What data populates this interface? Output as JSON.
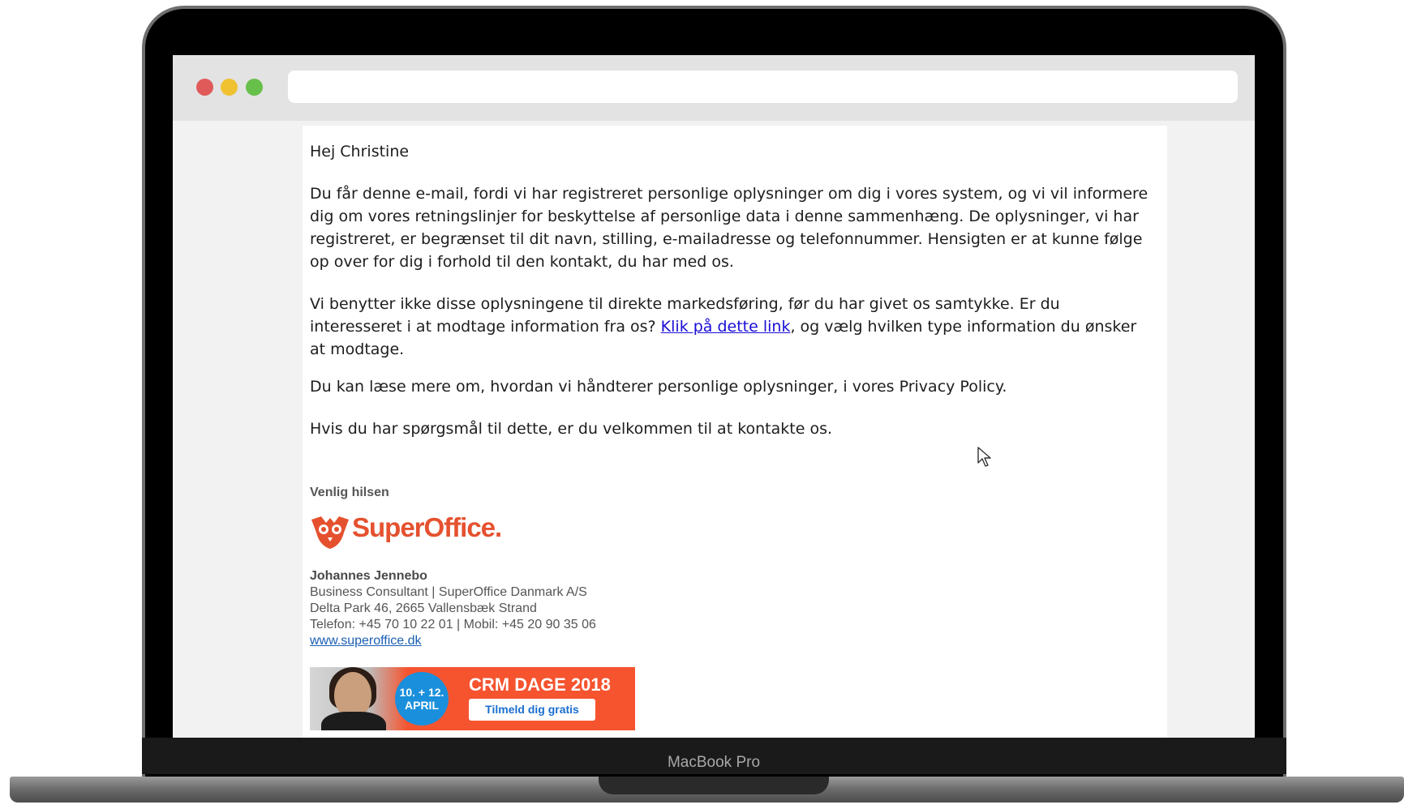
{
  "device": {
    "model_label": "MacBook Pro"
  },
  "email": {
    "greeting": "Hej Christine",
    "paragraphs": [
      "Du får denne e-mail, fordi vi har registreret personlige oplysninger om dig i vores system, og vi vil informere dig om vores retningslinjer for beskyttelse af personlige data i denne sammenhæng. De oplysninger, vi har registreret, er begrænset til dit navn, stilling, e-mailadresse og telefonnummer. Hensigten er at kunne følge op over for dig i forhold til den kontakt, du har med os.",
      "Du kan læse mere om, hvordan vi håndterer personlige oplysninger, i vores Privacy Policy.",
      "Hvis du har spørgsmål til dette, er du velkommen til at kontakte os."
    ],
    "para2_before": "Vi benytter ikke disse oplysningene til direkte markedsføring, før du har givet os samtykke. Er du interesseret i at modtage information fra os? ",
    "para2_link": "Klik på dette link",
    "para2_after": ", og vælg hvilken type information du ønsker at modtage."
  },
  "signature": {
    "greeting": "Venlig hilsen",
    "logo_text": "SuperOffice.",
    "name": "Johannes Jennebo",
    "title": "Business Consultant | SuperOffice Danmark A/S",
    "address": "Delta Park 46, 2665 Vallensbæk Strand",
    "phone": "Telefon: +45 70 10 22 01 | Mobil: +45 20 90 35 06",
    "website": "www.superoffice.dk"
  },
  "banner": {
    "badge_line1": "10. + 12.",
    "badge_line2": "APRIL",
    "title": "CRM DAGE 2018",
    "button": "Tilmeld dig gratis"
  },
  "colors": {
    "brand": "#e5512f",
    "link": "#1a0dd6",
    "banner_bg": "#f5542f",
    "badge": "#1a8fdc"
  }
}
